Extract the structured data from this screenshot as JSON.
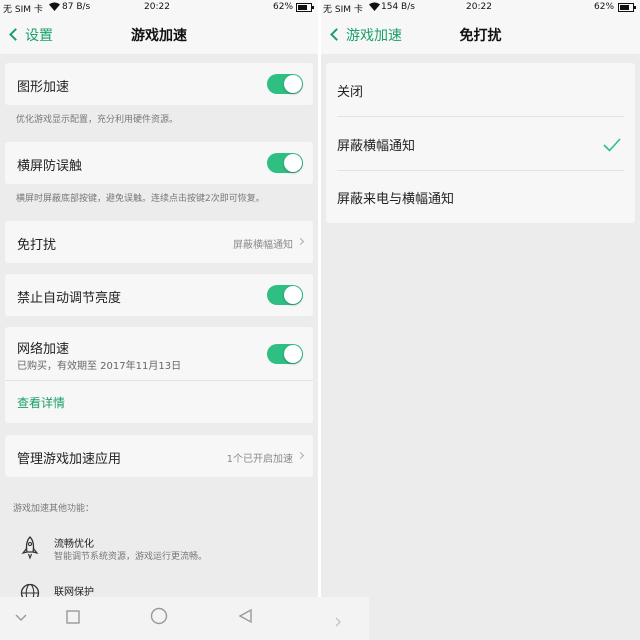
{
  "left_screen": {
    "status": {
      "carrier": "无 SIM 卡",
      "speed": "87 B/s",
      "time": "20:22",
      "battery": "62%"
    },
    "header": {
      "back_label": "设置",
      "title": "游戏加速"
    },
    "graphics": {
      "label": "图形加速",
      "on": true,
      "desc": "优化游戏显示配置，充分利用硬件资源。"
    },
    "landscape": {
      "label": "横屏防误触",
      "on": true,
      "desc": "横屏时屏蔽底部按键，避免误触。连续点击按键2次即可恢复。"
    },
    "dnd": {
      "label": "免打扰",
      "value": "屏蔽横幅通知"
    },
    "brightness": {
      "label": "禁止自动调节亮度",
      "on": true
    },
    "network": {
      "label": "网络加速",
      "sub": "已购买，有效期至 2017年11月13日",
      "on": true,
      "link": "查看详情"
    },
    "manage": {
      "label": "管理游戏加速应用",
      "value": "1个已开启加速"
    },
    "other": {
      "heading": "游戏加速其他功能：",
      "items": [
        {
          "title": "流畅优化",
          "desc": "智能调节系统资源，游戏运行更流畅。",
          "icon": "rocket-icon"
        },
        {
          "title": "联网保护",
          "desc": "",
          "icon": "globe-icon"
        }
      ]
    }
  },
  "right_screen": {
    "status": {
      "carrier": "无 SIM 卡",
      "speed": "154 B/s",
      "time": "20:22",
      "battery": "62%"
    },
    "header": {
      "back_label": "游戏加速",
      "title": "免打扰"
    },
    "options": [
      {
        "label": "关闭",
        "selected": false
      },
      {
        "label": "屏蔽横幅通知",
        "selected": true
      },
      {
        "label": "屏蔽来电与横幅通知",
        "selected": false
      }
    ]
  },
  "colors": {
    "accent": "#19a06a",
    "toggle_on": "#2fbf82",
    "background": "#ececec",
    "card": "#f7f7f7"
  }
}
